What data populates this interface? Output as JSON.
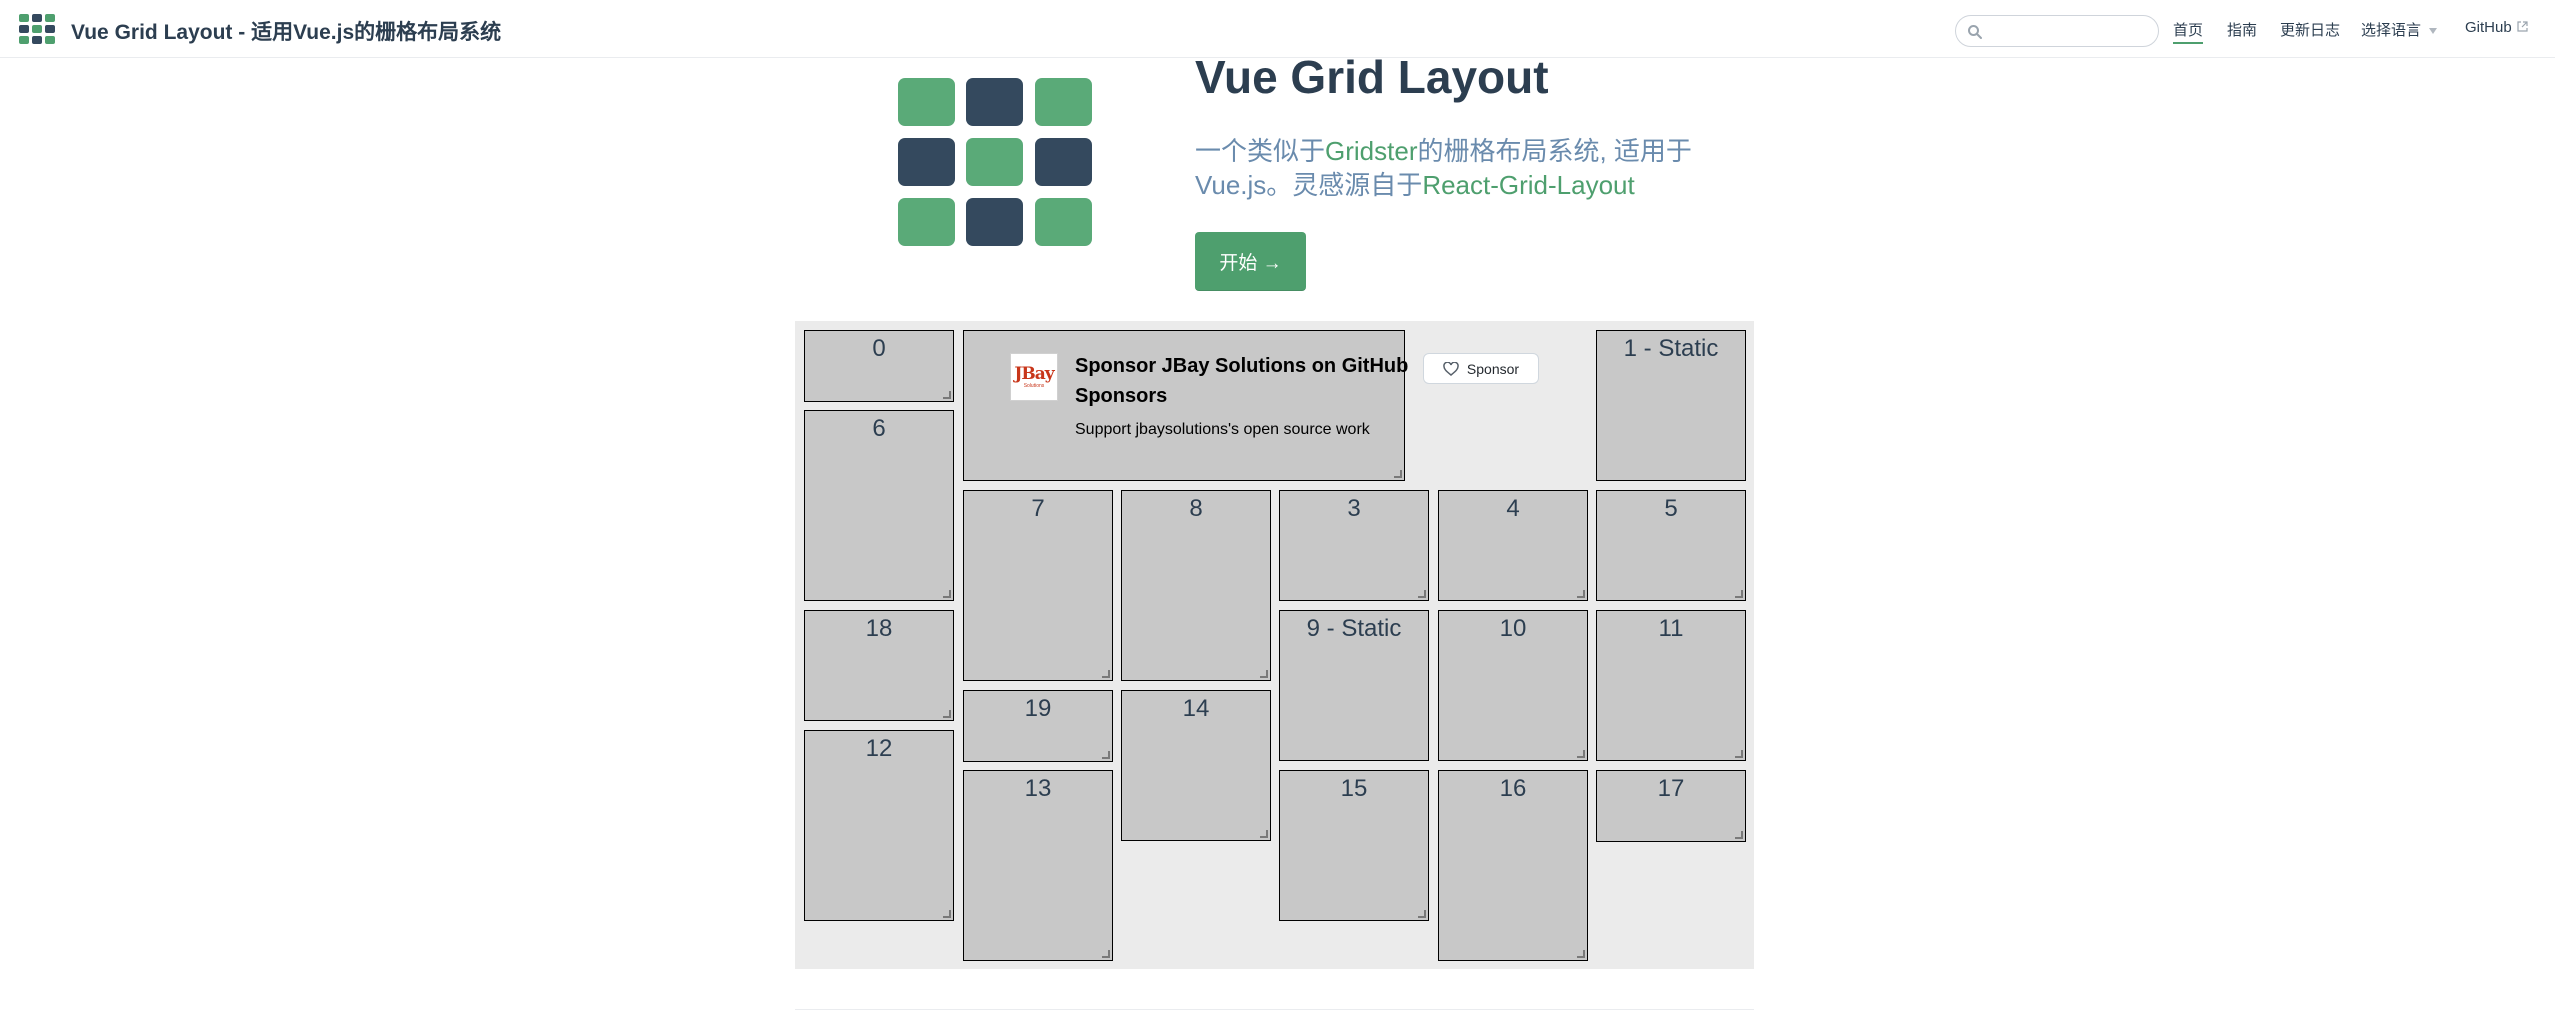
{
  "navbar": {
    "site_name": "Vue Grid Layout - 适用Vue.js的栅格布局系统",
    "search_placeholder": "",
    "links": [
      {
        "label": "首页",
        "active": true
      },
      {
        "label": "指南",
        "active": false
      },
      {
        "label": "更新日志",
        "active": false
      },
      {
        "label": "选择语言",
        "dropdown": true
      },
      {
        "label": "GitHub",
        "external": true
      }
    ]
  },
  "hero": {
    "title": "Vue Grid Layout",
    "desc_part1": "一个类似于",
    "desc_link1": "Gridster",
    "desc_part2": "的栅格布局系统, 适用于Vue.js。灵感源自于",
    "desc_link2": "React-Grid-Layout",
    "cta_label": "开始 →"
  },
  "sponsor": {
    "logo_text": "JBay",
    "logo_sub": "Solutions",
    "title": "Sponsor JBay Solutions on GitHub Sponsors",
    "description": "Support jbaysolutions's open source work",
    "button_label": "Sponsor"
  },
  "grid_items": [
    {
      "id": "0",
      "label": "0"
    },
    {
      "id": "1",
      "label": "1 - Static"
    },
    {
      "id": "6",
      "label": "6"
    },
    {
      "id": "7",
      "label": "7"
    },
    {
      "id": "8",
      "label": "8"
    },
    {
      "id": "3",
      "label": "3"
    },
    {
      "id": "4",
      "label": "4"
    },
    {
      "id": "5",
      "label": "5"
    },
    {
      "id": "18",
      "label": "18"
    },
    {
      "id": "9",
      "label": "9 - Static"
    },
    {
      "id": "10",
      "label": "10"
    },
    {
      "id": "11",
      "label": "11"
    },
    {
      "id": "19",
      "label": "19"
    },
    {
      "id": "14",
      "label": "14"
    },
    {
      "id": "12",
      "label": "12"
    },
    {
      "id": "13",
      "label": "13"
    },
    {
      "id": "15",
      "label": "15"
    },
    {
      "id": "16",
      "label": "16"
    },
    {
      "id": "17",
      "label": "17"
    }
  ],
  "colors": {
    "accent": "#4e9f6e",
    "dark": "#34495e",
    "text": "#2c3e50",
    "muted": "#6a8bad",
    "grid_bg": "#ebebeb",
    "item_bg": "#c8c8c8"
  },
  "icons": {
    "logo": "grid-logo-icon",
    "search": "search-icon",
    "dropdown": "chevron-down-icon",
    "external": "external-link-icon",
    "heart": "heart-icon",
    "resize": "resize-handle-icon"
  }
}
